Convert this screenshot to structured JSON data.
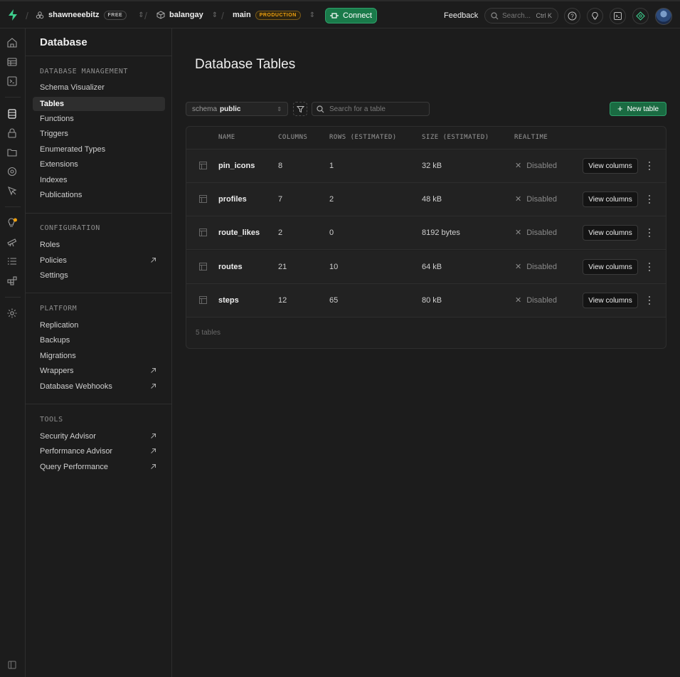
{
  "topbar": {
    "org": "shawneeebitz",
    "org_badge": "FREE",
    "project": "balangay",
    "branch": "main",
    "branch_badge": "PRODUCTION",
    "connect_label": "Connect",
    "feedback_label": "Feedback",
    "search_placeholder": "Search...",
    "search_shortcut": "Ctrl K"
  },
  "sidebar": {
    "title": "Database",
    "sections": [
      {
        "label": "DATABASE MANAGEMENT",
        "items": [
          {
            "label": "Schema Visualizer"
          },
          {
            "label": "Tables",
            "active": true
          },
          {
            "label": "Functions"
          },
          {
            "label": "Triggers"
          },
          {
            "label": "Enumerated Types"
          },
          {
            "label": "Extensions"
          },
          {
            "label": "Indexes"
          },
          {
            "label": "Publications"
          }
        ]
      },
      {
        "label": "CONFIGURATION",
        "items": [
          {
            "label": "Roles"
          },
          {
            "label": "Policies",
            "external": true
          },
          {
            "label": "Settings"
          }
        ]
      },
      {
        "label": "PLATFORM",
        "items": [
          {
            "label": "Replication"
          },
          {
            "label": "Backups"
          },
          {
            "label": "Migrations"
          },
          {
            "label": "Wrappers",
            "external": true
          },
          {
            "label": "Database Webhooks",
            "external": true
          }
        ]
      },
      {
        "label": "TOOLS",
        "items": [
          {
            "label": "Security Advisor",
            "external": true
          },
          {
            "label": "Performance Advisor",
            "external": true
          },
          {
            "label": "Query Performance",
            "external": true
          }
        ]
      }
    ]
  },
  "main": {
    "title": "Database Tables",
    "schema_label": "schema",
    "schema_value": "public",
    "search_placeholder": "Search for a table",
    "new_table_label": "New table",
    "columns": [
      "NAME",
      "COLUMNS",
      "ROWS (ESTIMATED)",
      "SIZE (ESTIMATED)",
      "REALTIME"
    ],
    "rows": [
      {
        "name": "pin_icons",
        "columns": "8",
        "rows": "1",
        "size": "32 kB",
        "realtime": "Disabled"
      },
      {
        "name": "profiles",
        "columns": "7",
        "rows": "2",
        "size": "48 kB",
        "realtime": "Disabled"
      },
      {
        "name": "route_likes",
        "columns": "2",
        "rows": "0",
        "size": "8192 bytes",
        "realtime": "Disabled"
      },
      {
        "name": "routes",
        "columns": "21",
        "rows": "10",
        "size": "64 kB",
        "realtime": "Disabled"
      },
      {
        "name": "steps",
        "columns": "12",
        "rows": "65",
        "size": "80 kB",
        "realtime": "Disabled"
      }
    ],
    "view_columns_label": "View columns",
    "footer": "5 tables"
  },
  "colors": {
    "brand_green": "#3ecf8e",
    "connect_bg": "#1a7a4a",
    "production": "#f1a10d"
  }
}
